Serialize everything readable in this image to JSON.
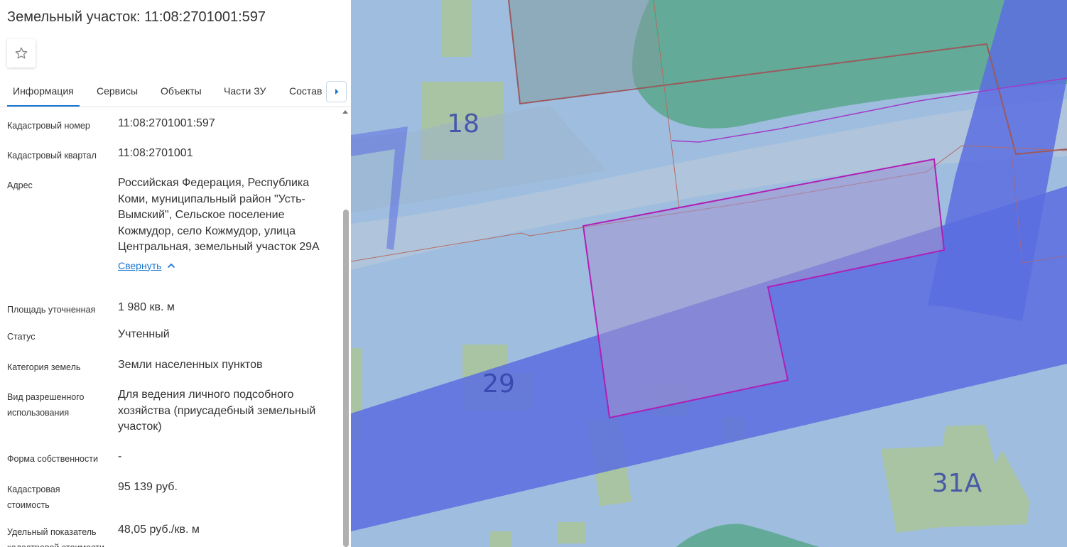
{
  "panel": {
    "title": "Земельный участок: 11:08:2701001:597",
    "favorite_icon": "star-icon",
    "tabs": [
      {
        "label": "Информация",
        "active": true
      },
      {
        "label": "Сервисы",
        "active": false
      },
      {
        "label": "Объекты",
        "active": false
      },
      {
        "label": "Части ЗУ",
        "active": false
      },
      {
        "label": "Состав",
        "active": false
      }
    ],
    "tabs_next_icon": "chevron-right-icon",
    "collapse_link": "Свернуть",
    "fields": [
      {
        "label": "Кадастровый номер",
        "value": "11:08:2701001:597"
      },
      {
        "label": "Кадастровый квартал",
        "value": "11:08:2701001"
      },
      {
        "label": "Адрес",
        "value": "Российская Федерация, Республика Коми, муниципальный район \"Усть-Вымский\", Сельское поселение Кожмудор, село Кожмудор, улица Центральная, земельный участок 29А"
      },
      {
        "label": "Площадь уточненная",
        "value": "1 980 кв. м"
      },
      {
        "label": "Статус",
        "value": "Учтенный"
      },
      {
        "label": "Категория земель",
        "value": "Земли населенных пунктов"
      },
      {
        "label": "Вид разрешенного использования",
        "value": "Для ведения личного подсобного хозяйства (приусадебный земельный участок)"
      },
      {
        "label": "Форма собственности",
        "value": "-"
      },
      {
        "label": "Кадастровая стоимость",
        "value": "95 139 руб."
      },
      {
        "label": "Удельный показатель кадастровой стоимости",
        "value": "48,05 руб./кв. м"
      }
    ]
  },
  "map": {
    "house_numbers": [
      "18",
      "29",
      "31А"
    ],
    "colors": {
      "background": "#9fbedf",
      "building": "#a9c4a2",
      "forest": "#63ab98",
      "road_band": "#5b6de0",
      "selected_parcel_fill": "#a393cf",
      "selected_parcel_stroke": "#b01fb5",
      "parcel_border": "#9a5a5e"
    }
  }
}
